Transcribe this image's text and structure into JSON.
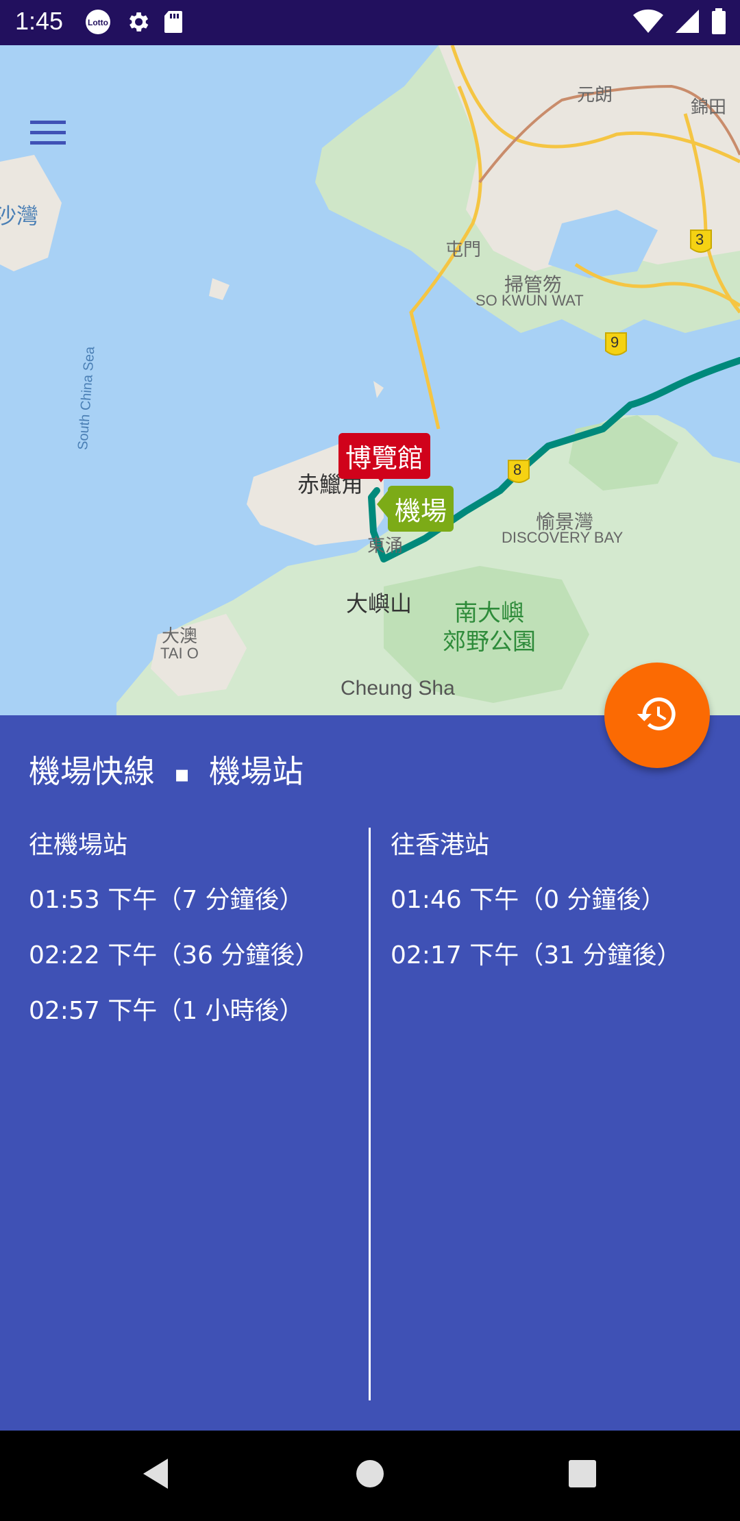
{
  "status_bar": {
    "time": "1:45",
    "left_icons": [
      "lotto-icon",
      "gear-icon",
      "sd-card-icon"
    ],
    "right_icons": [
      "wifi-icon",
      "cell-signal-icon",
      "battery-icon"
    ]
  },
  "map": {
    "labels": {
      "yuen_long": "元朗",
      "kam_tin": "錦田",
      "tuen_mun": "屯門",
      "so_kwun_wat_zh": "掃管笏",
      "so_kwun_wat_en": "SO KWUN WAT",
      "sha_wan": "沙灣",
      "south_china_sea": "South China Sea",
      "chek_lap_kok": "赤鱲角",
      "tung_chung": "東涌",
      "discovery_bay_zh": "愉景灣",
      "discovery_bay_en": "DISCOVERY BAY",
      "lantau": "大嶼山",
      "tai_o_zh": "大澳",
      "tai_o_en": "TAI O",
      "park_line1": "南大嶼",
      "park_line2": "郊野公園",
      "cheung_sha": "Cheung Sha"
    },
    "route_shields": [
      "3",
      "9",
      "8"
    ],
    "markers": {
      "asiaworld_expo": "博覽館",
      "airport": "機場"
    },
    "colors": {
      "route": "#00897b",
      "water": "#a8d1f5"
    }
  },
  "menu_icon": "hamburger-menu-icon",
  "fab_icon": "history-icon",
  "panel": {
    "line_name": "機場快線",
    "separator": "▪",
    "station_name": "機場站",
    "to_airport": {
      "header": "往機場站",
      "times": [
        "01:53 下午（7 分鐘後）",
        "02:22 下午（36 分鐘後）",
        "02:57 下午（1 小時後）"
      ]
    },
    "to_hong_kong": {
      "header": "往香港站",
      "times": [
        "01:46 下午（0 分鐘後）",
        "02:17 下午（31 分鐘後）"
      ]
    }
  },
  "colors": {
    "panel": "#3f51b5",
    "fab": "#fb6a03",
    "status_bar": "#22105e"
  },
  "nav_icons": [
    "back-icon",
    "home-icon",
    "recents-icon"
  ]
}
